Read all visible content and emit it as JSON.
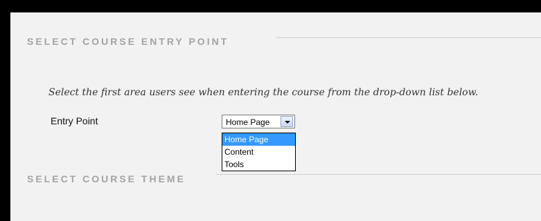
{
  "sections": {
    "entry_point_title": "SELECT COURSE ENTRY POINT",
    "theme_title": "SELECT COURSE THEME"
  },
  "instructions": "Select the first area users see when entering the course from the drop-down list below.",
  "entry_point": {
    "label": "Entry Point",
    "selected": "Home Page",
    "options": [
      "Home Page",
      "Content",
      "Tools"
    ],
    "highlighted_index": 0
  },
  "colors": {
    "frame": "#000000",
    "panel_bg": "#f2f2f2",
    "section_heading": "#a3a3a3",
    "option_highlight": "#3399ff"
  }
}
